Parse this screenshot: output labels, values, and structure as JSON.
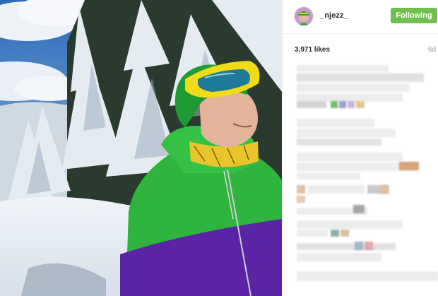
{
  "post": {
    "username": "_njezz_",
    "follow_label": "Following",
    "likes": "3,971 likes",
    "time_ago": "6d"
  },
  "colors": {
    "follow_button": "#70c050",
    "username_text": "#262626",
    "muted_text": "#999999",
    "divider": "#efefef",
    "pixelated_comment": "#e1e1e1"
  },
  "icons": [
    "avatar",
    "pixelated-comments"
  ]
}
